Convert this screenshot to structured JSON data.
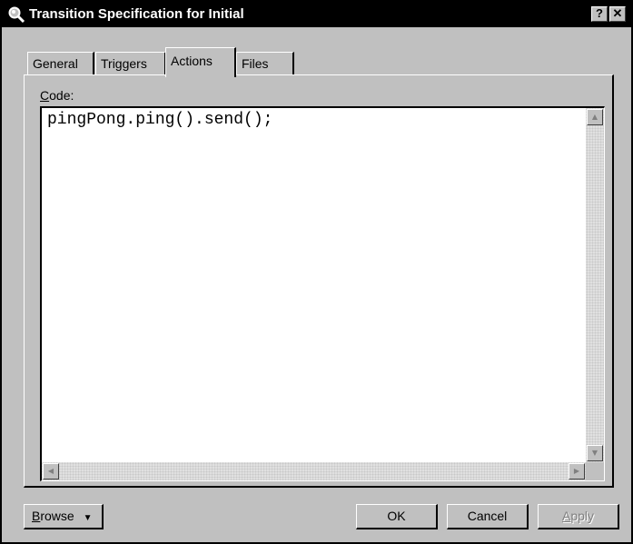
{
  "window": {
    "title": "Transition Specification for Initial",
    "help_label": "?",
    "close_label": "✕"
  },
  "tabs": [
    {
      "label": "General",
      "active": false
    },
    {
      "label": "Triggers",
      "active": false
    },
    {
      "label": "Actions",
      "active": true
    },
    {
      "label": "Files",
      "active": false
    }
  ],
  "code": {
    "label_mnemonic": "C",
    "label_rest": "ode:",
    "value": "pingPong.ping().send();"
  },
  "buttons": {
    "browse": "Browse",
    "browse_mnemonic": "B",
    "browse_rest": "rowse",
    "ok": "OK",
    "cancel": "Cancel",
    "apply": "Apply",
    "apply_mnemonic": "A",
    "apply_rest": "pply"
  },
  "icons": {
    "title": "magnifier-icon",
    "browse_dropdown": "caret-down-icon"
  },
  "colors": {
    "face": "#c0c0c0",
    "titlebar": "#000000",
    "disabled_text": "#808080"
  }
}
